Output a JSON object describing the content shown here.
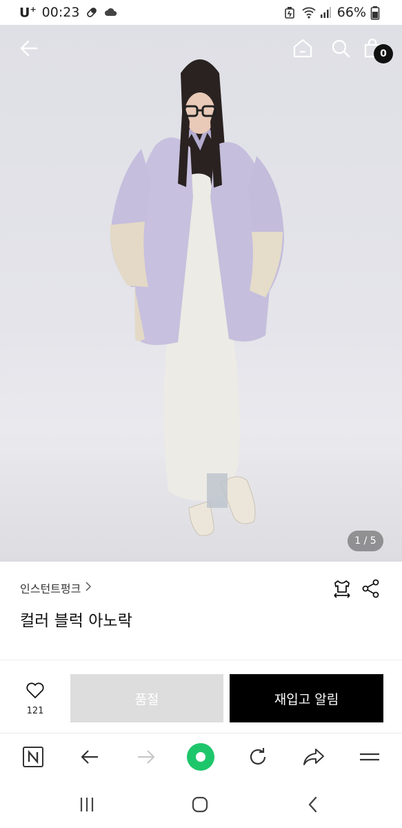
{
  "status_bar": {
    "carrier": "U",
    "carrier_sup": "+",
    "time": "00:23",
    "battery": "66%"
  },
  "hero": {
    "page_indicator": "1 / 5",
    "cart_count": "0"
  },
  "product": {
    "brand": "인스턴트펑크",
    "name": "컬러 블럭 아노락"
  },
  "actions": {
    "like_count": "121",
    "soldout_label": "품절",
    "restock_label": "재입고 알림"
  },
  "colors": {
    "primary_button": "#000000",
    "disabled_button": "#dddddd",
    "browser_accent": "#1ec66b"
  },
  "icons": {
    "top_bar": [
      "back-arrow-icon",
      "home-icon",
      "search-icon",
      "shopping-bag-icon"
    ],
    "info": [
      "size-guide-icon",
      "share-icon"
    ],
    "browser": [
      "naver-icon",
      "back-icon",
      "forward-icon",
      "green-dot-icon",
      "refresh-icon",
      "share-arrow-icon",
      "menu-icon"
    ],
    "system": [
      "recent-apps-icon",
      "home-button-icon",
      "back-nav-icon"
    ]
  }
}
